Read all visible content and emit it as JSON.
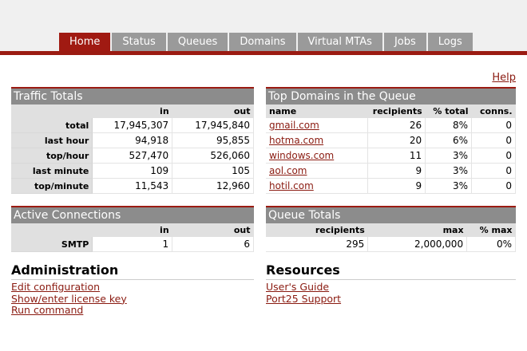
{
  "nav": {
    "tabs": [
      "Home",
      "Status",
      "Queues",
      "Domains",
      "Virtual MTAs",
      "Jobs",
      "Logs"
    ],
    "active": "Home"
  },
  "help_label": "Help",
  "traffic": {
    "title": "Traffic Totals",
    "col_in": "in",
    "col_out": "out",
    "rows": [
      {
        "label": "total",
        "in": "17,945,307",
        "out": "17,945,840"
      },
      {
        "label": "last hour",
        "in": "94,918",
        "out": "95,855"
      },
      {
        "label": "top/hour",
        "in": "527,470",
        "out": "526,060"
      },
      {
        "label": "last minute",
        "in": "109",
        "out": "105"
      },
      {
        "label": "top/minute",
        "in": "11,543",
        "out": "12,960"
      }
    ]
  },
  "top_domains": {
    "title": "Top Domains in the Queue",
    "headers": {
      "name": "name",
      "recipients": "recipients",
      "pct_total": "% total",
      "conns": "conns."
    },
    "rows": [
      {
        "name": "gmail.com",
        "recipients": "26",
        "pct_total": "8%",
        "conns": "0"
      },
      {
        "name": "hotma.com",
        "recipients": "20",
        "pct_total": "6%",
        "conns": "0"
      },
      {
        "name": "windows.com",
        "recipients": "11",
        "pct_total": "3%",
        "conns": "0"
      },
      {
        "name": "aol.com",
        "recipients": "9",
        "pct_total": "3%",
        "conns": "0"
      },
      {
        "name": "hotil.com",
        "recipients": "9",
        "pct_total": "3%",
        "conns": "0"
      }
    ]
  },
  "connections": {
    "title": "Active Connections",
    "col_in": "in",
    "col_out": "out",
    "rows": [
      {
        "label": "SMTP",
        "in": "1",
        "out": "6"
      }
    ]
  },
  "queue_totals": {
    "title": "Queue Totals",
    "headers": {
      "recipients": "recipients",
      "max": "max",
      "pct_max": "% max"
    },
    "values": {
      "recipients": "295",
      "max": "2,000,000",
      "pct_max": "0%"
    }
  },
  "administration": {
    "title": "Administration",
    "links": [
      "Edit configuration",
      "Show/enter license key",
      "Run command"
    ]
  },
  "resources": {
    "title": "Resources",
    "links": [
      "User's Guide",
      "Port25 Support"
    ]
  },
  "colors": {
    "accent": "#9b1b12",
    "tab": "#9a9a9a",
    "panel_header": "#8c8c8c",
    "link": "#8a1a10"
  }
}
